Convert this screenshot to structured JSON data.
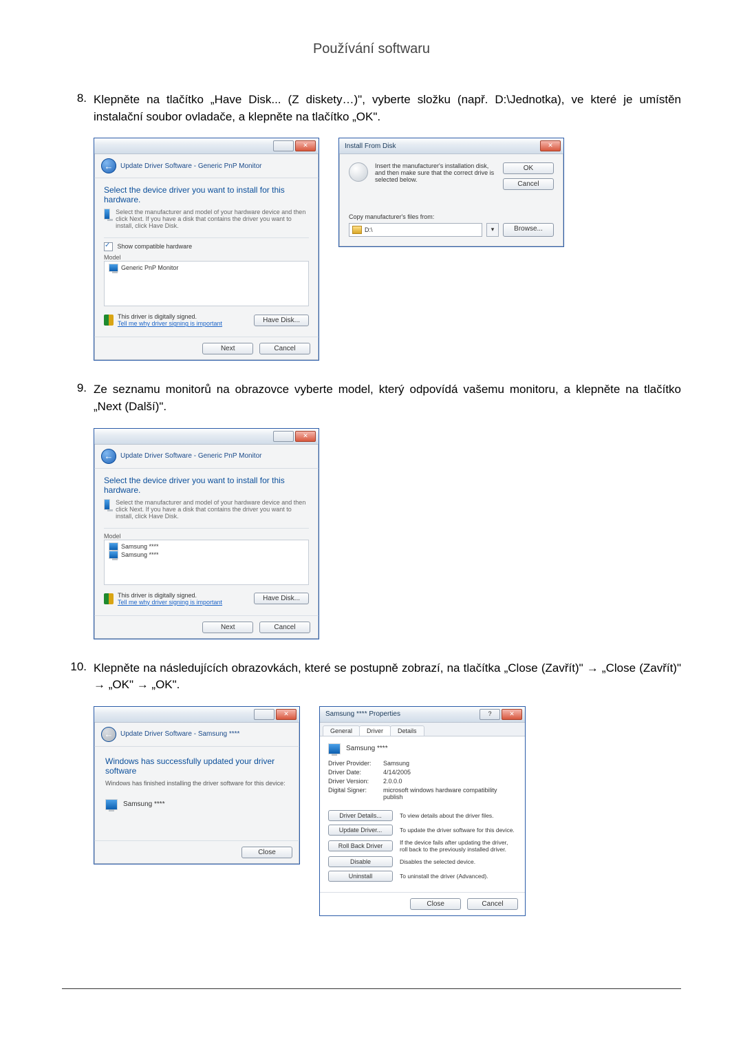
{
  "page_title": "Používání softwaru",
  "steps": {
    "s8": {
      "num": "8.",
      "text": "Klepněte na tlačítko „Have Disk... (Z diskety…)\", vyberte složku (např. D:\\Jednotka), ve které je umístěn instalační soubor ovladače, a klepněte na tlačítko „OK\"."
    },
    "s9": {
      "num": "9.",
      "text": "Ze seznamu monitorů na obrazovce vyberte model, který odpovídá vašemu monitoru, a klepněte na tlačítko „Next (Další)\"."
    },
    "s10": {
      "num": "10.",
      "text": "Klepněte na následujících obrazovkách, které se postupně zobrazí, na tlačítka „Close (Zavřít)\" → „Close (Zavřít)\" → „OK\" → „OK\"."
    }
  },
  "dlg1": {
    "crumb": "Update Driver Software - Generic PnP Monitor",
    "head": "Select the device driver you want to install for this hardware.",
    "sub": "Select the manufacturer and model of your hardware device and then click Next. If you have a disk that contains the driver you want to install, click Have Disk.",
    "show_compat": "Show compatible hardware",
    "model_lbl": "Model",
    "model_item": "Generic PnP Monitor",
    "signed": "This driver is digitally signed.",
    "signlink": "Tell me why driver signing is important",
    "have_disk": "Have Disk...",
    "next": "Next",
    "cancel": "Cancel"
  },
  "ifd": {
    "title": "Install From Disk",
    "msg": "Insert the manufacturer's installation disk, and then make sure that the correct drive is selected below.",
    "ok": "OK",
    "cancel": "Cancel",
    "copy_lbl": "Copy manufacturer's files from:",
    "path": "D:\\",
    "browse": "Browse..."
  },
  "dlg2": {
    "crumb": "Update Driver Software - Generic PnP Monitor",
    "head": "Select the device driver you want to install for this hardware.",
    "sub": "Select the manufacturer and model of your hardware device and then click Next. If you have a disk that contains the driver you want to install, click Have Disk.",
    "model_lbl": "Model",
    "m1": "Samsung ****",
    "m2": "Samsung ****",
    "signed": "This driver is digitally signed.",
    "signlink": "Tell me why driver signing is important",
    "have_disk": "Have Disk...",
    "next": "Next",
    "cancel": "Cancel"
  },
  "succ": {
    "crumb": "Update Driver Software - Samsung ****",
    "head": "Windows has successfully updated your driver software",
    "line": "Windows has finished installing the driver software for this device:",
    "dev": "Samsung ****",
    "close": "Close"
  },
  "props": {
    "title": "Samsung **** Properties",
    "tab_general": "General",
    "tab_driver": "Driver",
    "tab_details": "Details",
    "dev": "Samsung ****",
    "k_provider": "Driver Provider:",
    "v_provider": "Samsung",
    "k_date": "Driver Date:",
    "v_date": "4/14/2005",
    "k_version": "Driver Version:",
    "v_version": "2.0.0.0",
    "k_signer": "Digital Signer:",
    "v_signer": "microsoft windows hardware compatibility publish",
    "b_details": "Driver Details...",
    "d_details": "To view details about the driver files.",
    "b_update": "Update Driver...",
    "d_update": "To update the driver software for this device.",
    "b_roll": "Roll Back Driver",
    "d_roll": "If the device fails after updating the driver, roll back to the previously installed driver.",
    "b_disable": "Disable",
    "d_disable": "Disables the selected device.",
    "b_uninstall": "Uninstall",
    "d_uninstall": "To uninstall the driver (Advanced).",
    "close": "Close",
    "cancel": "Cancel"
  }
}
